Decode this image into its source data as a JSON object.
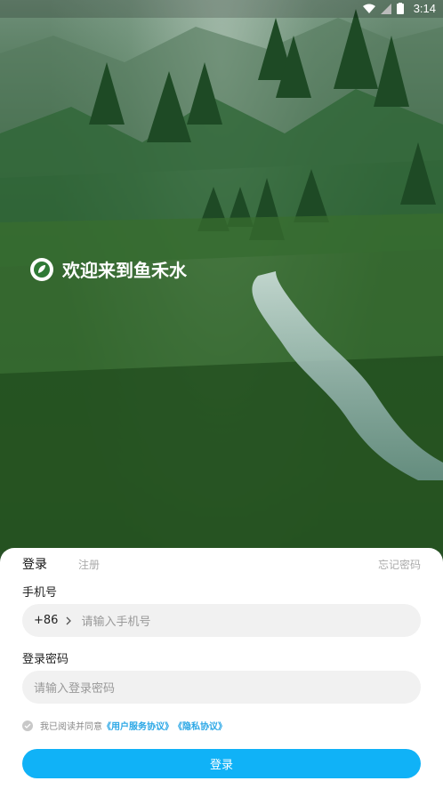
{
  "status_bar": {
    "time": "3:14"
  },
  "welcome": {
    "text": "欢迎来到鱼禾水"
  },
  "tabs": {
    "login": "登录",
    "register": "注册"
  },
  "forgot_password": "忘记密码",
  "phone": {
    "label": "手机号",
    "prefix": "+86",
    "placeholder": "请输入手机号"
  },
  "password": {
    "label": "登录密码",
    "placeholder": "请输入登录密码"
  },
  "agreement": {
    "text": "我已阅读并同意",
    "user_agreement": "《用户服务协议》",
    "privacy": "《隐私协议》"
  },
  "login_button": "登录",
  "colors": {
    "primary": "#10b2f7",
    "link": "#2aa7e6"
  }
}
